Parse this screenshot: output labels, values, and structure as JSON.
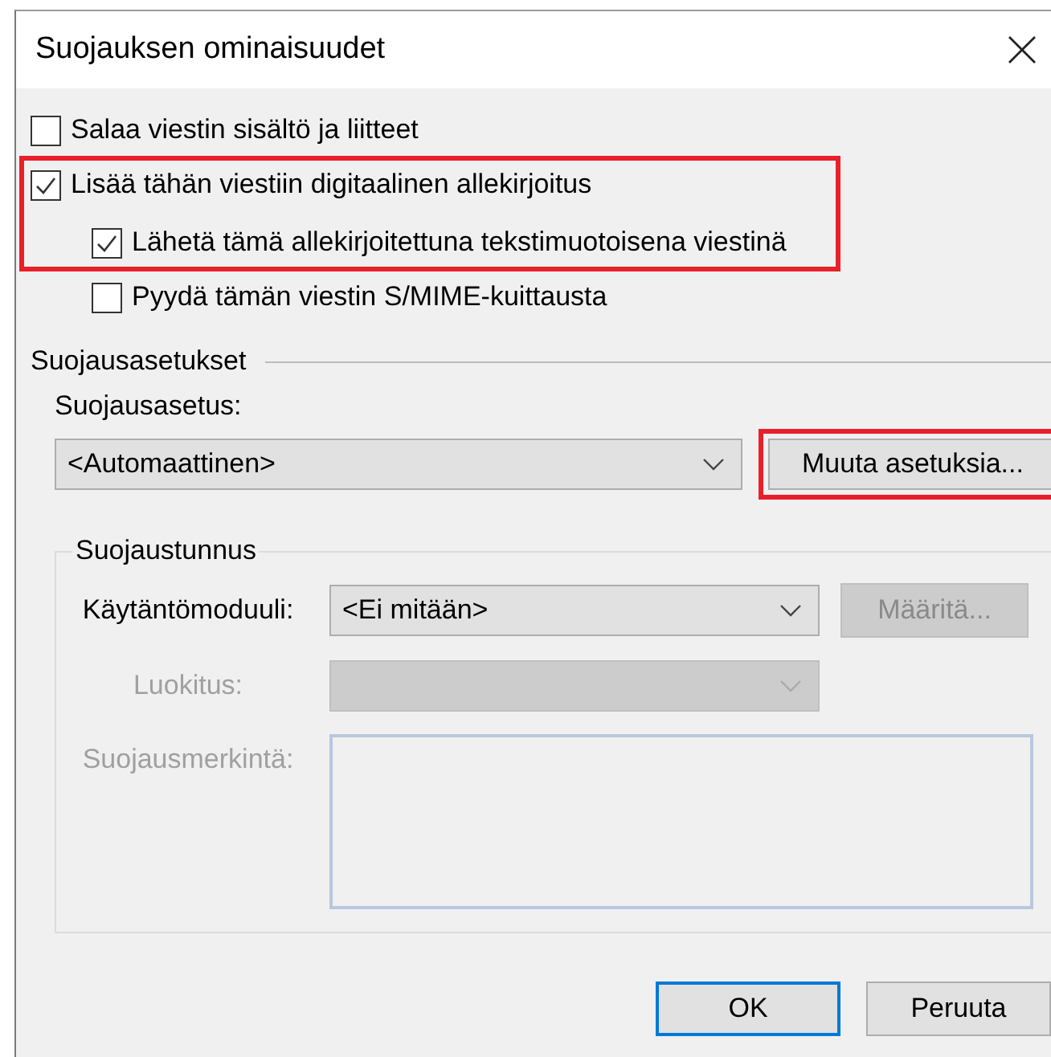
{
  "window": {
    "title": "Suojauksen ominaisuudet"
  },
  "options": [
    {
      "label": "Salaa viestin sisältö ja liitteet",
      "checked": false,
      "highlighted": false
    },
    {
      "label": "Lisää tähän viestiin digitaalinen allekirjoitus",
      "checked": true,
      "highlighted": true,
      "children": [
        {
          "label": "Lähetä tämä allekirjoitettuna tekstimuotoisena viestinä",
          "checked": true,
          "highlighted": true
        },
        {
          "label": "Pyydä tämän viestin S/MIME-kuittausta",
          "checked": false,
          "highlighted": false
        }
      ]
    }
  ],
  "security_settings": {
    "heading": "Suojausasetukset",
    "setting_label": "Suojausasetus:",
    "setting_value": "<Automaattinen>",
    "change_button": {
      "label": "Muuta asetuksia...",
      "highlighted": true
    }
  },
  "security_label": {
    "heading": "Suojaustunnus",
    "fields": [
      {
        "kind": "select",
        "label": "Käytäntömoduuli:",
        "value": "<Ei mitään>",
        "disabled": false,
        "button": {
          "label": "Määritä...",
          "disabled": true
        }
      },
      {
        "kind": "select",
        "label": "Luokitus:",
        "disabled": true
      },
      {
        "kind": "textarea",
        "label": "Suojausmerkintä:",
        "disabled": true
      }
    ]
  },
  "buttons": [
    {
      "label": "OK",
      "default": true
    },
    {
      "label": "Peruuta",
      "default": false
    }
  ]
}
